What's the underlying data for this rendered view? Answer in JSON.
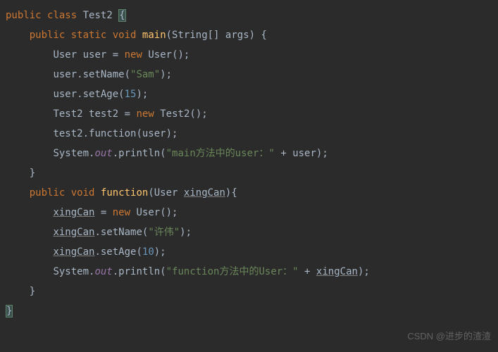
{
  "code": {
    "line1": {
      "kw1": "public",
      "kw2": "class",
      "name": "Test2",
      "brace": "{"
    },
    "line2": {
      "kw1": "public",
      "kw2": "static",
      "kw3": "void",
      "method": "main",
      "params": "(String[] args) {"
    },
    "line3": {
      "type": "User",
      "var": "user",
      "op": "=",
      "kw": "new",
      "ctor": "User",
      "tail": "();"
    },
    "line4": {
      "obj": "user",
      "call": ".setName(",
      "str": "\"Sam\"",
      "tail": ");"
    },
    "line5": {
      "obj": "user",
      "call": ".setAge(",
      "num": "15",
      "tail": ");"
    },
    "line6": {
      "type": "Test2",
      "var": "test2",
      "op": "=",
      "kw": "new",
      "ctor": "Test2",
      "tail": "();"
    },
    "line7": {
      "obj": "test2",
      "call": ".function(user);"
    },
    "line8": {
      "cls": "System",
      "dot1": ".",
      "out": "out",
      "dot2": ".println(",
      "str": "\"main方法中的user：\"",
      "plus": " + user);"
    },
    "line9": {
      "brace": "}"
    },
    "line10": {
      "kw1": "public",
      "kw2": "void",
      "method": "function",
      "params_open": "(User ",
      "param": "xingCan",
      "params_close": "){"
    },
    "line11": {
      "var": "xingCan",
      "op": " = ",
      "kw": "new",
      "ctor": " User",
      "tail": "();"
    },
    "line12": {
      "var": "xingCan",
      "call": ".setName(",
      "str": "\"许伟\"",
      "tail": ");"
    },
    "line13": {
      "var": "xingCan",
      "call": ".setAge(",
      "num": "10",
      "tail": ");"
    },
    "line14": {
      "cls": "System",
      "dot1": ".",
      "out": "out",
      "dot2": ".println(",
      "str": "\"function方法中的User：\"",
      "plus": " + ",
      "var": "xingCan",
      "tail": ");"
    },
    "line15": {
      "brace": "}"
    },
    "line16": {
      "brace": "}"
    }
  },
  "watermark": "CSDN @进步的渣渣",
  "side": ""
}
